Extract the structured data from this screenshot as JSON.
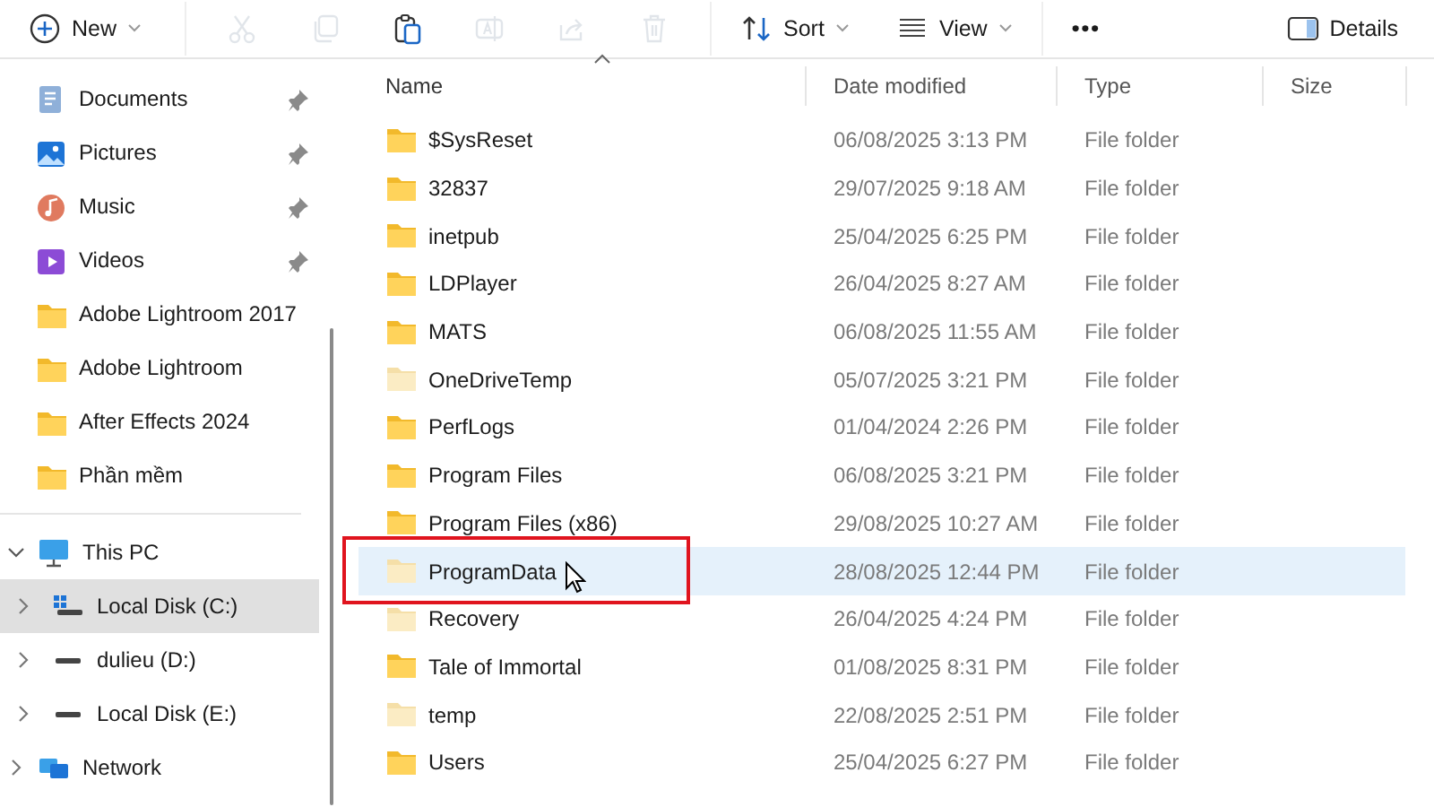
{
  "toolbar": [
    {
      "kind": "new",
      "label": "New",
      "dropdown": true,
      "disabled": false
    },
    {
      "kind": "divider"
    },
    {
      "kind": "cut",
      "disabled": true
    },
    {
      "kind": "copy",
      "disabled": true
    },
    {
      "kind": "paste",
      "disabled": false
    },
    {
      "kind": "rename",
      "disabled": true
    },
    {
      "kind": "share",
      "disabled": true
    },
    {
      "kind": "delete",
      "disabled": true
    },
    {
      "kind": "divider"
    },
    {
      "kind": "sort",
      "label": "Sort",
      "dropdown": true,
      "disabled": false
    },
    {
      "kind": "view",
      "label": "View",
      "dropdown": true,
      "disabled": false
    },
    {
      "kind": "divider"
    },
    {
      "kind": "more",
      "label": "•••",
      "disabled": false
    }
  ],
  "details_button": {
    "label": "Details"
  },
  "sidebar": {
    "quick_access": [
      {
        "label": "Documents",
        "kind": "documents",
        "pinned": true
      },
      {
        "label": "Pictures",
        "kind": "pictures",
        "pinned": true
      },
      {
        "label": "Music",
        "kind": "music",
        "pinned": true
      },
      {
        "label": "Videos",
        "kind": "videos",
        "pinned": true
      },
      {
        "label": "Adobe Lightroom 2017",
        "kind": "folder",
        "pinned": false
      },
      {
        "label": "Adobe Lightroom",
        "kind": "folder",
        "pinned": false
      },
      {
        "label": "After Effects 2024",
        "kind": "folder",
        "pinned": false
      },
      {
        "label": "Phần mềm",
        "kind": "folder",
        "pinned": false
      }
    ],
    "this_pc": {
      "label": "This PC",
      "expanded": true,
      "children": [
        {
          "label": "Local Disk (C:)",
          "kind": "system-drive",
          "selected": true
        },
        {
          "label": "dulieu (D:)",
          "kind": "drive",
          "selected": false
        },
        {
          "label": "Local Disk (E:)",
          "kind": "drive",
          "selected": false
        }
      ]
    },
    "network": {
      "label": "Network",
      "expanded": false
    }
  },
  "table": {
    "columns": [
      {
        "label": "Name",
        "sorted": true
      },
      {
        "label": "Date modified",
        "sorted": false
      },
      {
        "label": "Type",
        "sorted": false
      },
      {
        "label": "Size",
        "sorted": false
      }
    ],
    "rows": [
      {
        "name": "$SysReset",
        "date": "06/08/2025 3:13 PM",
        "type": "File folder",
        "hidden": false,
        "selected": false,
        "highlighted": false
      },
      {
        "name": "32837",
        "date": "29/07/2025 9:18 AM",
        "type": "File folder",
        "hidden": false,
        "selected": false,
        "highlighted": false
      },
      {
        "name": "inetpub",
        "date": "25/04/2025 6:25 PM",
        "type": "File folder",
        "hidden": false,
        "selected": false,
        "highlighted": false
      },
      {
        "name": "LDPlayer",
        "date": "26/04/2025 8:27 AM",
        "type": "File folder",
        "hidden": false,
        "selected": false,
        "highlighted": false
      },
      {
        "name": "MATS",
        "date": "06/08/2025 11:55 AM",
        "type": "File folder",
        "hidden": false,
        "selected": false,
        "highlighted": false
      },
      {
        "name": "OneDriveTemp",
        "date": "05/07/2025 3:21 PM",
        "type": "File folder",
        "hidden": true,
        "selected": false,
        "highlighted": false
      },
      {
        "name": "PerfLogs",
        "date": "01/04/2024 2:26 PM",
        "type": "File folder",
        "hidden": false,
        "selected": false,
        "highlighted": false
      },
      {
        "name": "Program Files",
        "date": "06/08/2025 3:21 PM",
        "type": "File folder",
        "hidden": false,
        "selected": false,
        "highlighted": false
      },
      {
        "name": "Program Files (x86)",
        "date": "29/08/2025 10:27 AM",
        "type": "File folder",
        "hidden": false,
        "selected": false,
        "highlighted": false
      },
      {
        "name": "ProgramData",
        "date": "28/08/2025 12:44 PM",
        "type": "File folder",
        "hidden": true,
        "selected": true,
        "highlighted": true
      },
      {
        "name": "Recovery",
        "date": "26/04/2025 4:24 PM",
        "type": "File folder",
        "hidden": true,
        "selected": false,
        "highlighted": false
      },
      {
        "name": "Tale of Immortal",
        "date": "01/08/2025 8:31 PM",
        "type": "File folder",
        "hidden": false,
        "selected": false,
        "highlighted": false
      },
      {
        "name": "temp",
        "date": "22/08/2025 2:51 PM",
        "type": "File folder",
        "hidden": true,
        "selected": false,
        "highlighted": false
      },
      {
        "name": "Users",
        "date": "25/04/2025 6:27 PM",
        "type": "File folder",
        "hidden": false,
        "selected": false,
        "highlighted": false
      }
    ]
  }
}
